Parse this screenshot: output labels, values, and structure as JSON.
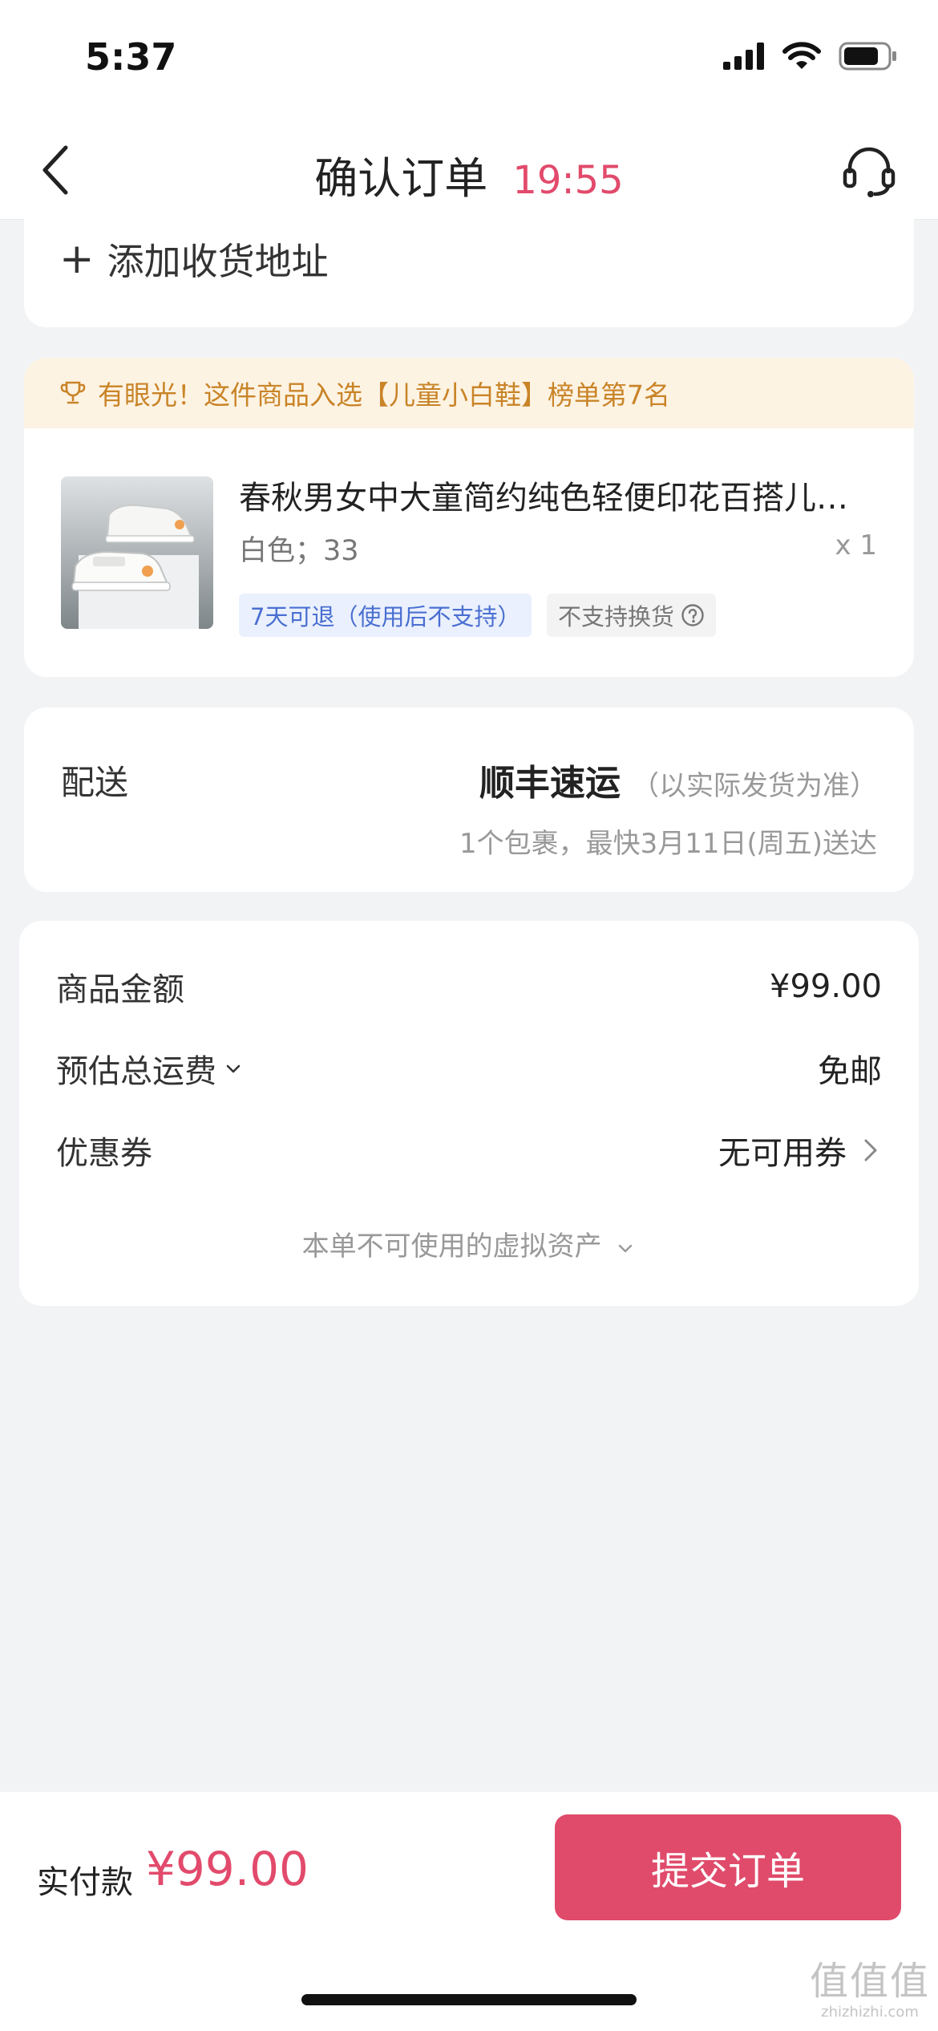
{
  "status_bar": {
    "time": "5:37"
  },
  "nav": {
    "title": "确认订单",
    "countdown": "19:55"
  },
  "address": {
    "add_label": "添加收货地址"
  },
  "product": {
    "rank_banner": "有眼光！这件商品入选【儿童小白鞋】榜单第7名",
    "title": "春秋男女中大童简约纯色轻便印花百搭儿…",
    "spec": "白色；33",
    "quantity": "x 1",
    "tag_return": "7天可退（使用后不支持）",
    "tag_no_exchange": "不支持换货"
  },
  "delivery": {
    "label": "配送",
    "method": "顺丰速运",
    "method_note": "（以实际发货为准）",
    "eta": "1个包裹，最快3月11日(周五)送达"
  },
  "pricing": {
    "goods_amount_label": "商品金额",
    "goods_amount_value": "¥99.00",
    "shipping_label": "预估总运费",
    "shipping_value": "免邮",
    "coupon_label": "优惠券",
    "coupon_value": "无可用券",
    "virtual_assets": "本单不可使用的虚拟资产"
  },
  "bottom_bar": {
    "pay_label": "实付款",
    "pay_amount": "¥99.00",
    "submit_label": "提交订单"
  },
  "watermark": {
    "glyphs": "值值值",
    "url": "zhizhizhi.com"
  },
  "colors": {
    "accent": "#e04b6b",
    "timer": "#e24a6b",
    "banner_bg": "#fdf3e3",
    "banner_text": "#c98428",
    "tag_blue": "#4a6fd1"
  },
  "icons": [
    "back-arrow-icon",
    "customer-service-icon",
    "plus-icon",
    "trophy-icon",
    "question-circle-icon",
    "chevron-down-icon",
    "chevron-right-icon",
    "signal-icon",
    "wifi-icon",
    "battery-icon"
  ]
}
